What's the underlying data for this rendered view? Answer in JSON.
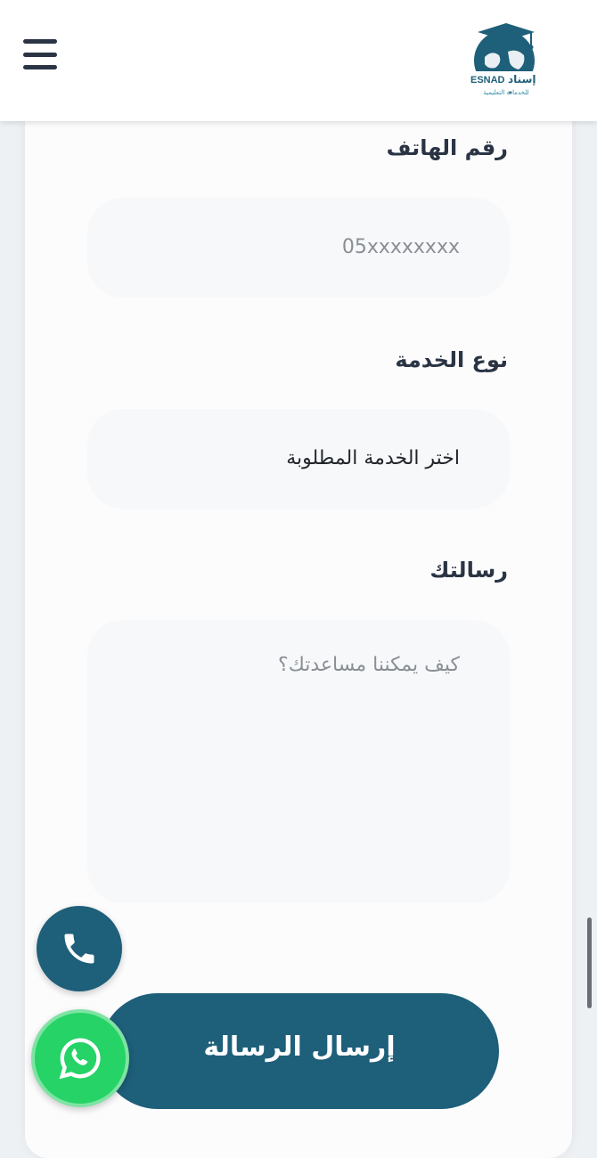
{
  "header": {
    "logo_en": "ESNAD",
    "logo_ar": "إسناد -",
    "logo_sub": "للخدمات التعليمية"
  },
  "form": {
    "phone": {
      "label": "رقم الهاتف",
      "placeholder": "05xxxxxxxx"
    },
    "service": {
      "label": "نوع الخدمة",
      "selected": "اختر الخدمة المطلوبة"
    },
    "message": {
      "label": "رسالتك",
      "placeholder": "كيف يمكننا مساعدتك؟"
    },
    "submit_label": "إرسال الرسالة"
  },
  "colors": {
    "brand": "#1e5f7a",
    "whatsapp": "#25d366",
    "text": "#2a3444"
  },
  "icons": {
    "menu": "hamburger-icon",
    "phone": "phone-icon",
    "whatsapp": "whatsapp-icon"
  }
}
